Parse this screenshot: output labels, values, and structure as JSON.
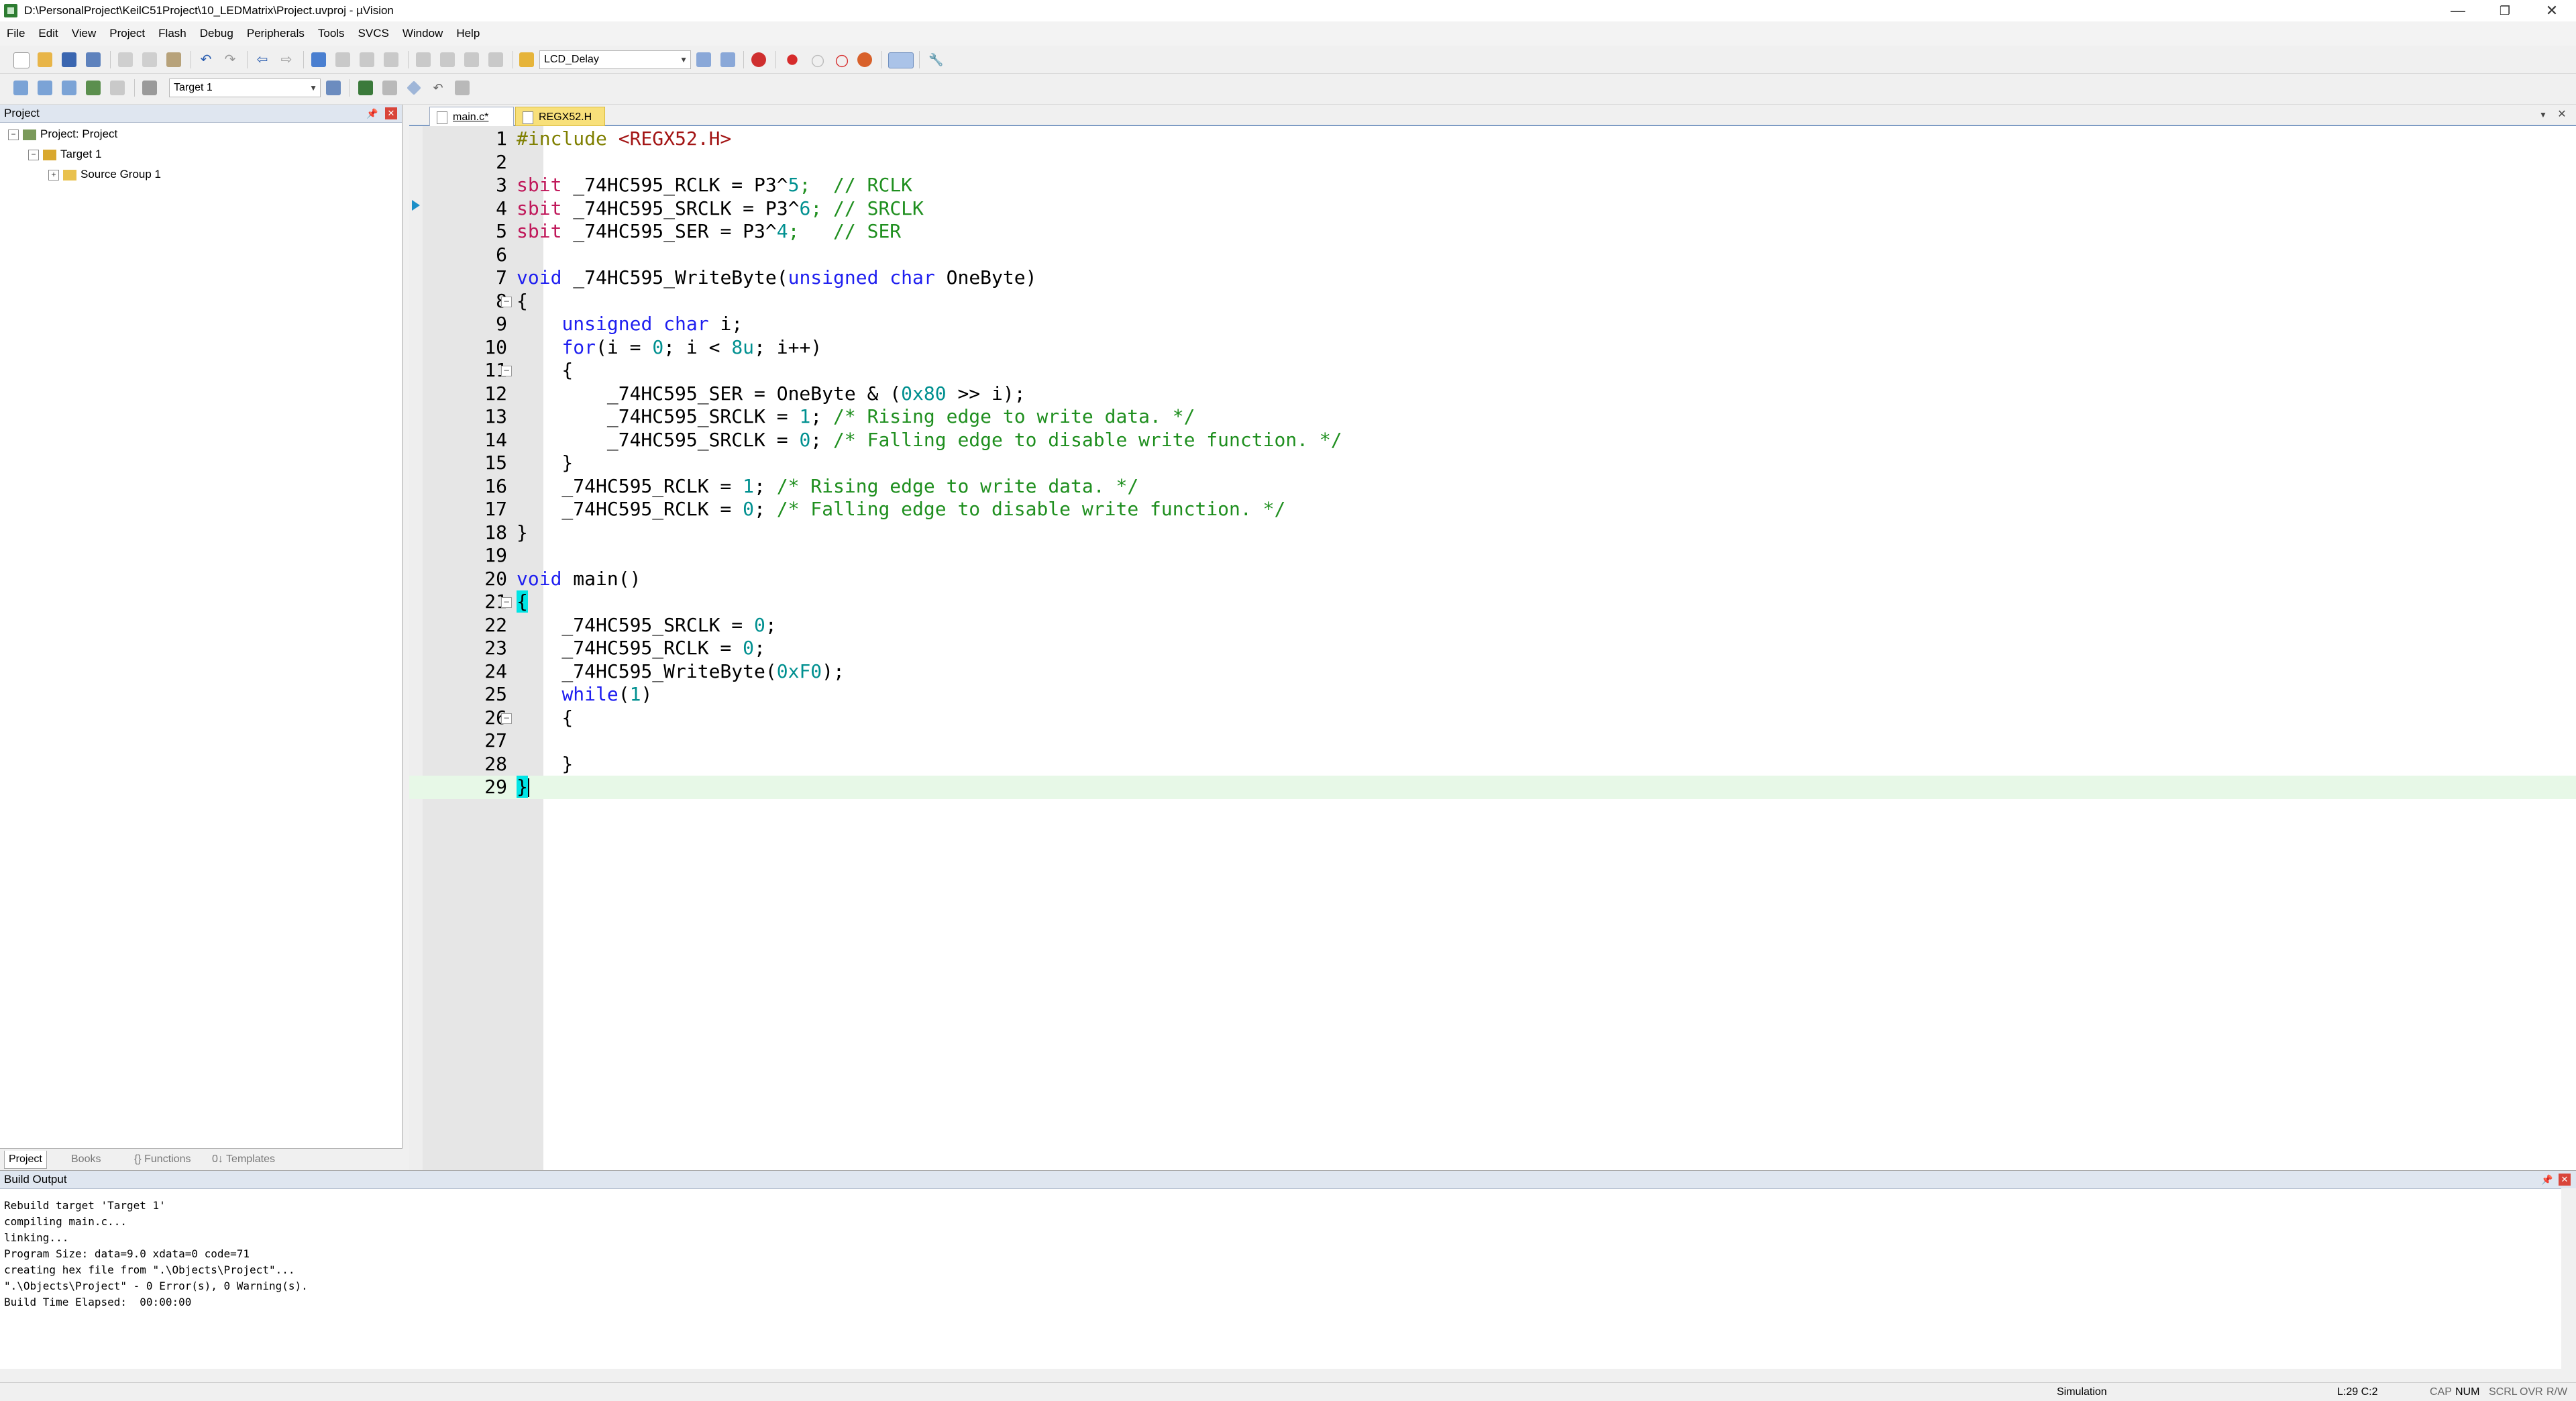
{
  "window": {
    "title": "D:\\PersonalProject\\KeilC51Project\\10_LEDMatrix\\Project.uvproj - µVision",
    "minimize": "—",
    "maximize": "❐",
    "close": "✕"
  },
  "menu": [
    "File",
    "Edit",
    "View",
    "Project",
    "Flash",
    "Debug",
    "Peripherals",
    "Tools",
    "SVCS",
    "Window",
    "Help"
  ],
  "toolbar1": {
    "find_combo": "LCD_Delay"
  },
  "toolbar2": {
    "target_combo": "Target 1"
  },
  "project_panel": {
    "title": "Project",
    "tree": {
      "root": "Project: Project",
      "target": "Target 1",
      "group": "Source Group 1"
    },
    "tabs": [
      "Project",
      "Books",
      "{} Functions",
      "0↓ Templates"
    ]
  },
  "editor": {
    "tabs": [
      "main.c*",
      "REGX52.H"
    ]
  },
  "code": {
    "1": "#include",
    "1b": "<REGX52.H>",
    "3a": "sbit",
    "3b": " _74HC595_RCLK = P3^",
    "3c": "5",
    "3d": ";  // RCLK",
    "4a": "sbit",
    "4b": " _74HC595_SRCLK = P3^",
    "4c": "6",
    "4d": "; // SRCLK",
    "5a": "sbit",
    "5b": " _74HC595_SER = P3^",
    "5c": "4",
    "5d": ";   // SER",
    "7a": "void",
    "7b": " _74HC595_WriteByte(",
    "7c": "unsigned char",
    "7d": " OneByte)",
    "8": "{",
    "9a": "    ",
    "9b": "unsigned char",
    "9c": " i;",
    "10a": "    ",
    "10b": "for",
    "10c": "(i = ",
    "10d": "0",
    "10e": "; i < ",
    "10f": "8u",
    "10g": "; i++)",
    "11": "    {",
    "12a": "        _74HC595_SER = OneByte & (",
    "12b": "0x80",
    "12c": " >> i);",
    "13a": "        _74HC595_SRCLK = ",
    "13b": "1",
    "13c": "; ",
    "13d": "/* Rising edge to write data. */",
    "14a": "        _74HC595_SRCLK = ",
    "14b": "0",
    "14c": "; ",
    "14d": "/* Falling edge to disable write function. */",
    "15": "    }",
    "16a": "    _74HC595_RCLK = ",
    "16b": "1",
    "16c": "; ",
    "16d": "/* Rising edge to write data. */",
    "17a": "    _74HC595_RCLK = ",
    "17b": "0",
    "17c": "; ",
    "17d": "/* Falling edge to disable write function. */",
    "18": "}",
    "20a": "void",
    "20b": " main()",
    "21": "{",
    "22a": "    _74HC595_SRCLK = ",
    "22b": "0",
    "22c": ";",
    "23a": "    _74HC595_RCLK = ",
    "23b": "0",
    "23c": ";",
    "24a": "    _74HC595_WriteByte(",
    "24b": "0xF0",
    "24c": ");",
    "25a": "    ",
    "25b": "while",
    "25c": "(",
    "25d": "1",
    "25e": ")",
    "26": "    {",
    "28": "    }",
    "29": "}"
  },
  "line_numbers": [
    "1",
    "2",
    "3",
    "4",
    "5",
    "6",
    "7",
    "8",
    "9",
    "10",
    "11",
    "12",
    "13",
    "14",
    "15",
    "16",
    "17",
    "18",
    "19",
    "20",
    "21",
    "22",
    "23",
    "24",
    "25",
    "26",
    "27",
    "28",
    "29"
  ],
  "build_output": {
    "title": "Build Output",
    "lines": "Rebuild target 'Target 1'\ncompiling main.c...\nlinking...\nProgram Size: data=9.0 xdata=0 code=71\ncreating hex file from \".\\Objects\\Project\"...\n\".\\Objects\\Project\" - 0 Error(s), 0 Warning(s).\nBuild Time Elapsed:  00:00:00"
  },
  "status": {
    "mode": "Simulation",
    "position": "L:29 C:2",
    "cap": "CAP",
    "num": "NUM",
    "scrl": "SCRL",
    "ovr": "OVR",
    "rw": "R/W"
  }
}
